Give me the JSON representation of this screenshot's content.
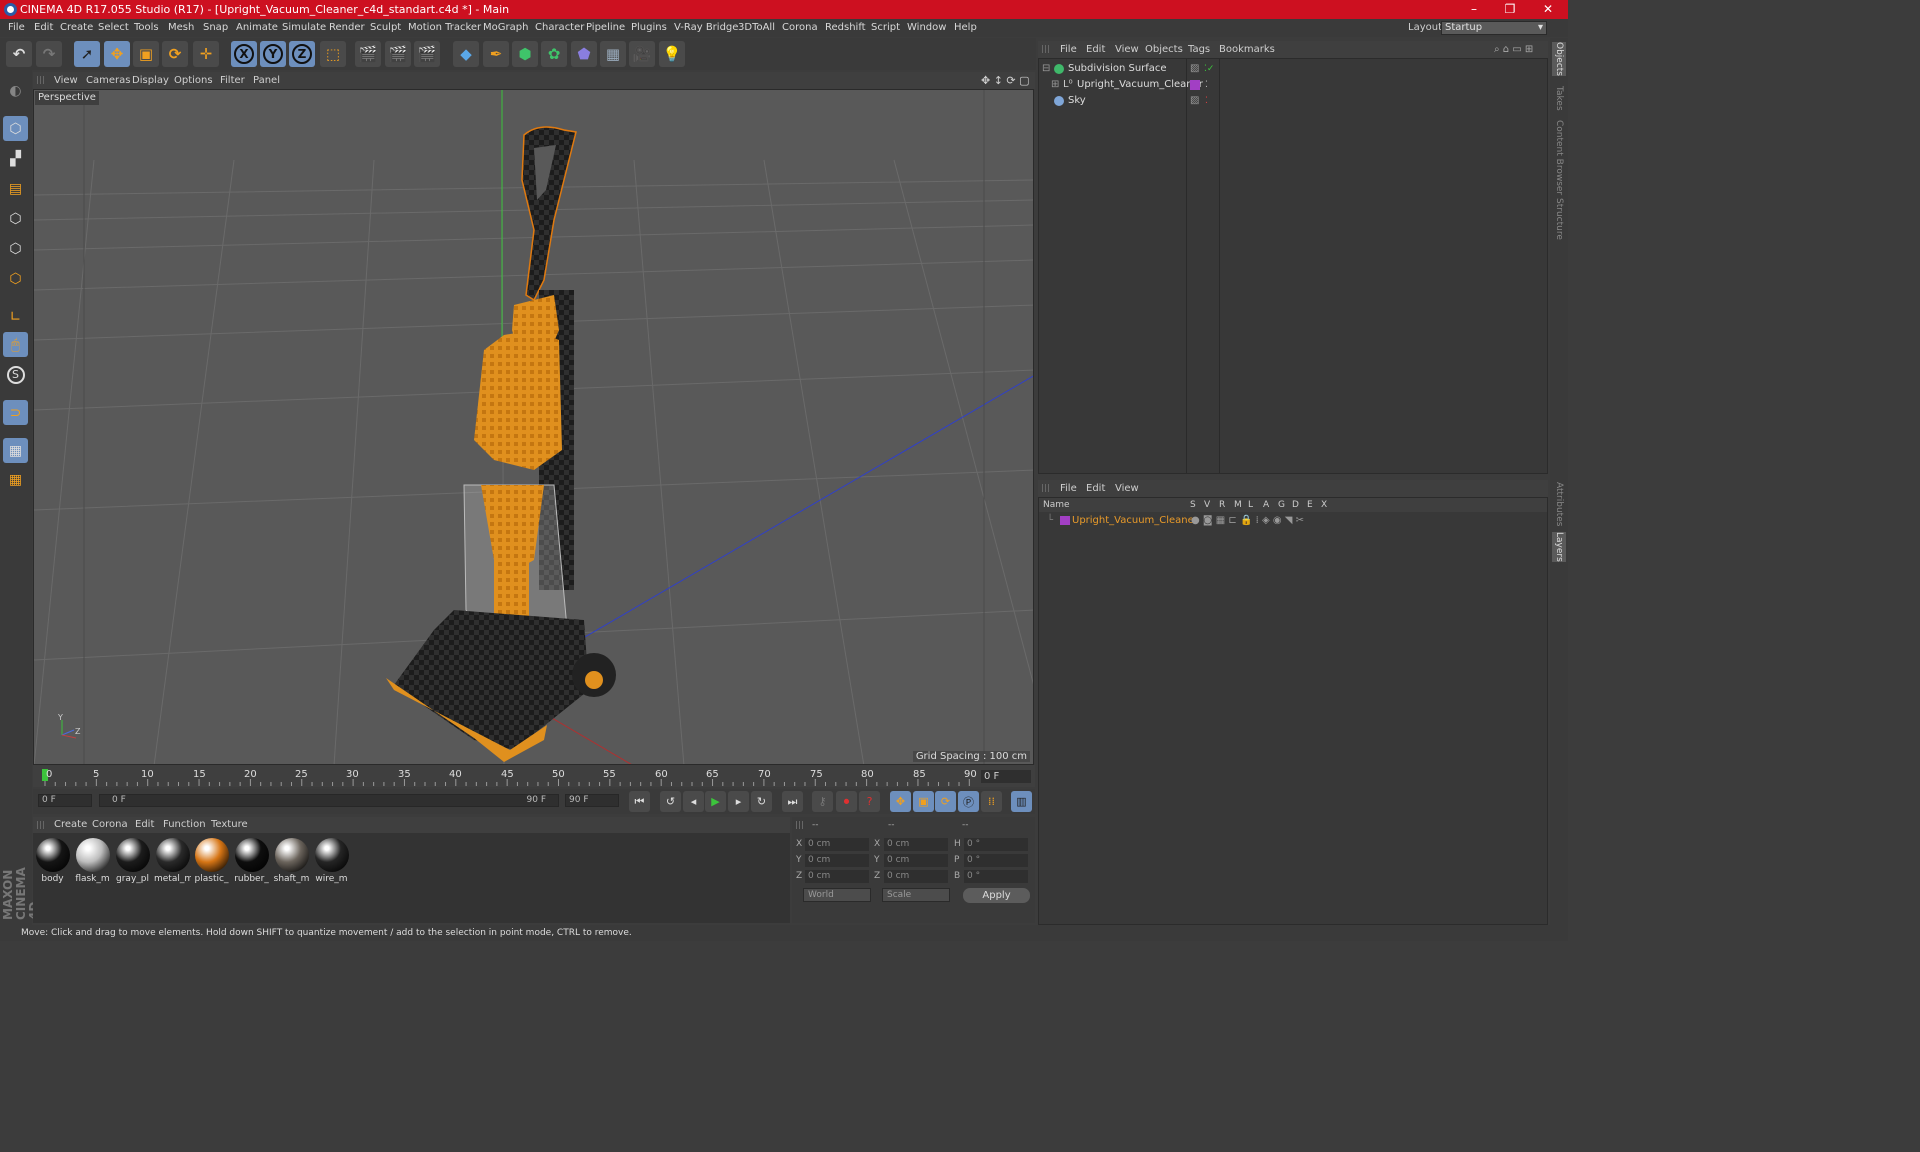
{
  "window": {
    "title": "CINEMA 4D R17.055 Studio (R17) - [Upright_Vacuum_Cleaner_c4d_standart.c4d *] - Main",
    "controls": [
      "–",
      "❐",
      "✕"
    ]
  },
  "menubar": {
    "items": [
      "File",
      "Edit",
      "Create",
      "Select",
      "Tools",
      "Mesh",
      "Snap",
      "Animate",
      "Simulate",
      "Render",
      "Sculpt",
      "Motion Tracker",
      "MoGraph",
      "Character",
      "Pipeline",
      "Plugins",
      "V-Ray Bridge",
      "3DToAll",
      "Corona",
      "Redshift",
      "Script",
      "Window",
      "Help"
    ],
    "layout_label": "Layout:",
    "layout_value": "Startup"
  },
  "toolbar": {
    "axis_labels": [
      "X",
      "Y",
      "Z"
    ]
  },
  "viewport": {
    "menu": [
      "View",
      "Cameras",
      "Display",
      "Options",
      "Filter",
      "Panel"
    ],
    "label": "Perspective",
    "grid_spacing": "Grid Spacing : 100 cm",
    "axis_labels": [
      "Y",
      "Z"
    ]
  },
  "timeline": {
    "ticks": [
      "0",
      "5",
      "10",
      "15",
      "20",
      "25",
      "30",
      "35",
      "40",
      "45",
      "50",
      "55",
      "60",
      "65",
      "70",
      "75",
      "80",
      "85",
      "90"
    ],
    "current_frame": "0 F"
  },
  "transport": {
    "start": "0 F",
    "range_start": "0 F",
    "range_end": "90 F",
    "end": "90 F"
  },
  "materials": {
    "menu": [
      "Create",
      "Corona",
      "Edit",
      "Function",
      "Texture"
    ],
    "items": [
      {
        "label": "body",
        "color": "#151515"
      },
      {
        "label": "flask_m",
        "color": "#bdbdbd"
      },
      {
        "label": "gray_pl",
        "color": "#1c1c1c"
      },
      {
        "label": "metal_m",
        "color": "#2a2a2a"
      },
      {
        "label": "plastic_",
        "color": "#d67515"
      },
      {
        "label": "rubber_",
        "color": "#0e0e0e"
      },
      {
        "label": "shaft_m",
        "color": "#6b645c"
      },
      {
        "label": "wire_m",
        "color": "#252525"
      }
    ]
  },
  "coords": {
    "headers": [
      "--",
      "--",
      "--"
    ],
    "rows": [
      {
        "a": "X",
        "av": "0 cm",
        "b": "X",
        "bv": "0 cm",
        "c": "H",
        "cv": "0 °"
      },
      {
        "a": "Y",
        "av": "0 cm",
        "b": "Y",
        "bv": "0 cm",
        "c": "P",
        "cv": "0 °"
      },
      {
        "a": "Z",
        "av": "0 cm",
        "b": "Z",
        "bv": "0 cm",
        "c": "B",
        "cv": "0 °"
      }
    ],
    "mode1": "World",
    "mode2": "Scale",
    "apply": "Apply"
  },
  "object_manager": {
    "menu": [
      "File",
      "Edit",
      "View",
      "Objects",
      "Tags",
      "Bookmarks"
    ],
    "objects": [
      {
        "name": "Subdivision Surface",
        "icon_color": "#3fb86a"
      },
      {
        "name": "Upright_Vacuum_Cleaner",
        "icon_color": "#b0b0b0",
        "tag_color": "#a23fc4"
      },
      {
        "name": "Sky",
        "icon_color": "#7fa6d8"
      }
    ]
  },
  "layer_manager": {
    "menu": [
      "File",
      "Edit",
      "View"
    ],
    "columns": [
      "Name",
      "S",
      "V",
      "R",
      "M",
      "L",
      "A",
      "G",
      "D",
      "E",
      "X"
    ],
    "layers": [
      {
        "name": "Upright_Vacuum_Cleaner",
        "color": "#e89a2a",
        "swatch": "#a23fc4"
      }
    ]
  },
  "right_tabs": [
    "Objects",
    "Takes",
    "Content Browser",
    "Structure",
    "Attributes",
    "Layers"
  ],
  "status": "Move: Click and drag to move elements. Hold down SHIFT to quantize movement / add to the selection in point mode, CTRL to remove.",
  "branding": "MAXON CINEMA 4D"
}
